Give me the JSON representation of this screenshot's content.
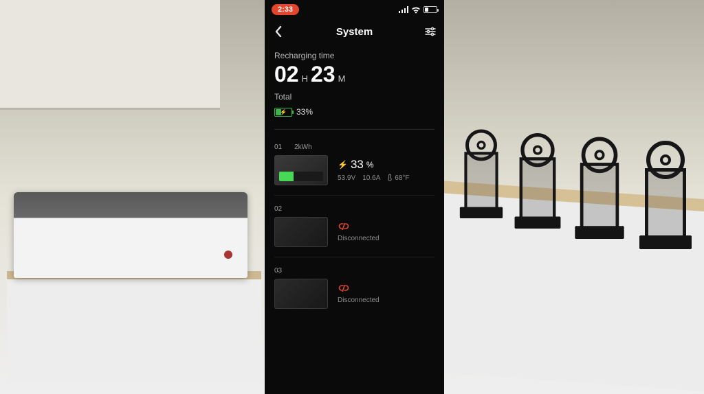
{
  "statusbar": {
    "time": "2:33"
  },
  "header": {
    "title": "System"
  },
  "recharging": {
    "label": "Recharging time",
    "hours": "02",
    "hours_unit": "H",
    "minutes": "23",
    "minutes_unit": "M",
    "total_label": "Total",
    "total_pct": "33%"
  },
  "modules": [
    {
      "id": "01",
      "capacity": "2kWh",
      "connected": true,
      "charge_pct_num": "33",
      "charge_pct_sign": "%",
      "voltage": "53.9V",
      "current": "10.6A",
      "temp": "68°F"
    },
    {
      "id": "02",
      "connected": false,
      "status": "Disconnected"
    },
    {
      "id": "03",
      "connected": false,
      "status": "Disconnected"
    }
  ]
}
